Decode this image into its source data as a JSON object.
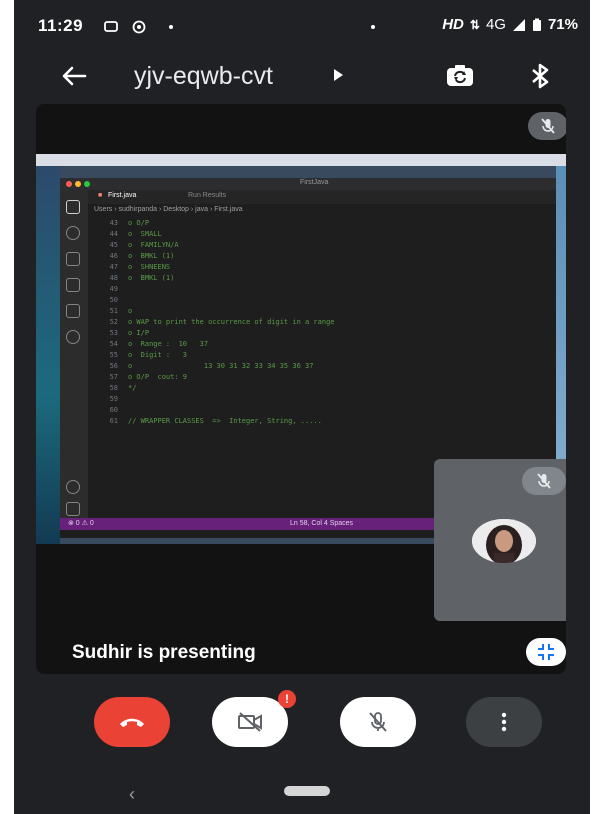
{
  "status_bar": {
    "time": "11:29",
    "network": "HD",
    "signal": "4G",
    "battery": "71%"
  },
  "app_bar": {
    "meeting_code": "yjv-eqwb-cvt"
  },
  "shared_screen": {
    "window_title": "FirstJava",
    "tabs": [
      "First.java",
      "Run Results"
    ],
    "breadcrumb": "Users › sudhirpanda › Desktop › java › First.java",
    "code_lines": [
      {
        "num": "43",
        "text": "o O/P"
      },
      {
        "num": "44",
        "text": "o  SMALL"
      },
      {
        "num": "45",
        "text": "o  FAMILYN/A"
      },
      {
        "num": "46",
        "text": "o  BMKL (1)"
      },
      {
        "num": "47",
        "text": "o  SHNEENS"
      },
      {
        "num": "48",
        "text": "o  BMKL (1)"
      },
      {
        "num": "49",
        "text": ""
      },
      {
        "num": "50",
        "text": ""
      },
      {
        "num": "51",
        "text": "o"
      },
      {
        "num": "52",
        "text": "o WAP to print the occurrence of digit in a range"
      },
      {
        "num": "53",
        "text": "o I/P"
      },
      {
        "num": "54",
        "text": "o  Range :  10   37"
      },
      {
        "num": "55",
        "text": "o  Digit :   3"
      },
      {
        "num": "56",
        "text": "o                 13 30 31 32 33 34 35 36 37"
      },
      {
        "num": "57",
        "text": "o O/P  cout: 9"
      },
      {
        "num": "58",
        "text": "*/"
      },
      {
        "num": "59",
        "text": ""
      },
      {
        "num": "60",
        "text": ""
      },
      {
        "num": "61",
        "text": "// WRAPPER CLASSES  =>  Integer, String, ....."
      }
    ],
    "status_left": "⊗ 0 ⚠ 0",
    "status_right": "Ln 58, Col 4   Spaces"
  },
  "presenting_text": "Sudhir is presenting",
  "controls": {
    "camera_badge": "!"
  },
  "icons": {
    "back": "arrow-left-icon",
    "switch_camera": "switch-camera-icon",
    "bluetooth": "bluetooth-icon",
    "mic_off": "mic-off-icon",
    "collapse": "collapse-icon",
    "end_call": "phone-hangup-icon",
    "camera_off": "camera-off-icon",
    "more": "more-vertical-icon"
  },
  "colors": {
    "end_call": "#ea4335",
    "background": "#202124",
    "statusbar_vscode": "#68217a"
  }
}
